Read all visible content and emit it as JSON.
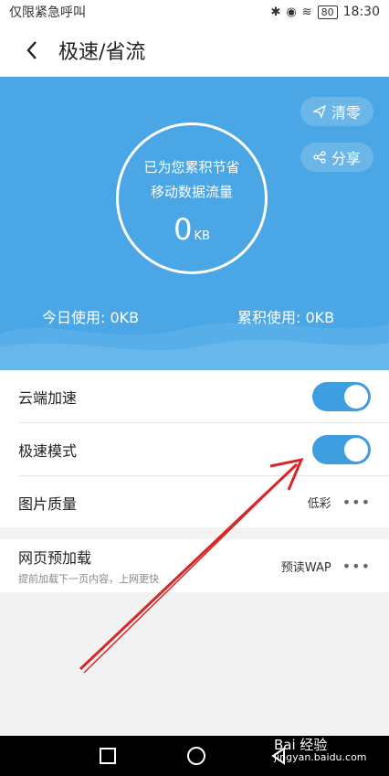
{
  "status_bar": {
    "carrier_text": "仅限紧急呼叫",
    "battery": "80",
    "time": "18:30"
  },
  "header": {
    "title": "极速/省流"
  },
  "hero": {
    "clear_label": "清零",
    "share_label": "分享",
    "circle_line1": "已为您累积节省",
    "circle_line2": "移动数据流量",
    "saved_value": "0",
    "saved_unit": "KB",
    "today_usage": "今日使用: 0KB",
    "total_usage": "累积使用: 0KB"
  },
  "settings": {
    "cloud_accel": {
      "label": "云端加速",
      "enabled": true
    },
    "speed_mode": {
      "label": "极速模式",
      "enabled": true
    },
    "image_quality": {
      "label": "图片质量",
      "value": "低彩"
    },
    "web_preload": {
      "label": "网页预加载",
      "description": "提前加载下一页内容，上网更快",
      "value": "预读WAP"
    },
    "more_glyph": "•••"
  },
  "watermark": {
    "brand": "Bai 经验",
    "site": "jingyan.baidu.com"
  },
  "colors": {
    "hero_bg": "#4aa6e4",
    "toggle_on": "#3f9ee0",
    "annotation_arrow": "#d62828"
  }
}
